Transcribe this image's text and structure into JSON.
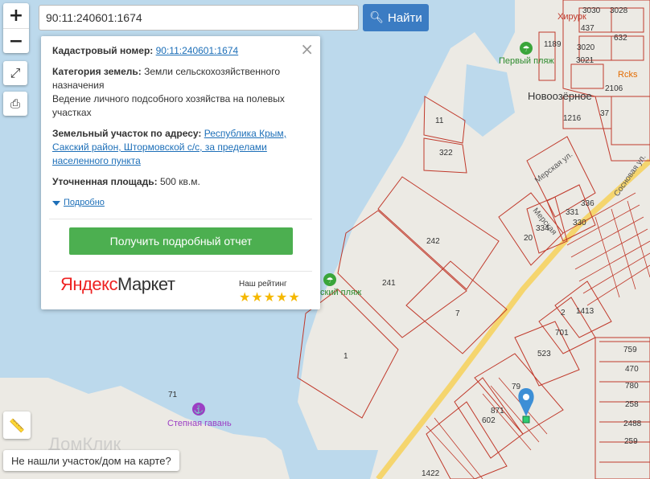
{
  "search": {
    "value": "90:11:240601:1674",
    "button_label": "Найти"
  },
  "zoom": {
    "in_label": "+",
    "out_label": "−"
  },
  "popup": {
    "cadastral_label": "Кадастровый номер:",
    "cadastral_value": "90:11:240601:1674",
    "category_label": "Категория земель:",
    "category_value_1": "Земли сельскохозяйственного",
    "category_value_2": "назначения",
    "usage_1": "Ведение личного подсобного хозяйства на полевых",
    "usage_2": "участках",
    "address_label": "Земельный участок по адресу:",
    "address_1": "Республика Крым,",
    "address_2": "Сакский район, Штормовской с/с, за пределами",
    "address_3": "населенного пункта",
    "area_label": "Уточненная площадь:",
    "area_value": "500 кв.м.",
    "more_label": "Подробно",
    "report_button": "Получить подробный отчет",
    "ad_brand_red": "Яндекс",
    "ad_brand": "Маркет",
    "rating_label": "Наш рейтинг",
    "stars": "★★★★★"
  },
  "bottom_link": "Не нашли участок/дом на карте?",
  "map_labels": {
    "town": "Новоозёрное",
    "beach1": "Первый пляж",
    "beach2": "ский пляж",
    "harbor": "Степная гавань",
    "street1": "Мерская ул.",
    "street2": "Сосновая ул.",
    "street3": "Мерская",
    "rcks": "Rcks",
    "watermark": "ДомКлик",
    "khz": "Хирурк"
  },
  "parcels": [
    "3030",
    "3028",
    "437",
    "632",
    "1189",
    "3020",
    "3021",
    "2106",
    "37",
    "1216",
    "11",
    "322",
    "242",
    "241",
    "7",
    "1",
    "336",
    "331",
    "330",
    "334",
    "20",
    "2",
    "1413",
    "701",
    "523",
    "79",
    "871",
    "602",
    "759",
    "470",
    "780",
    "258",
    "2488",
    "259",
    "1422",
    "71"
  ],
  "colors": {
    "water": "#bcd9ec",
    "land": "#eceae4",
    "parcel": "#c0392b",
    "road": "#f5d56e",
    "button": "#3b7cc3",
    "report": "#4caf50"
  }
}
